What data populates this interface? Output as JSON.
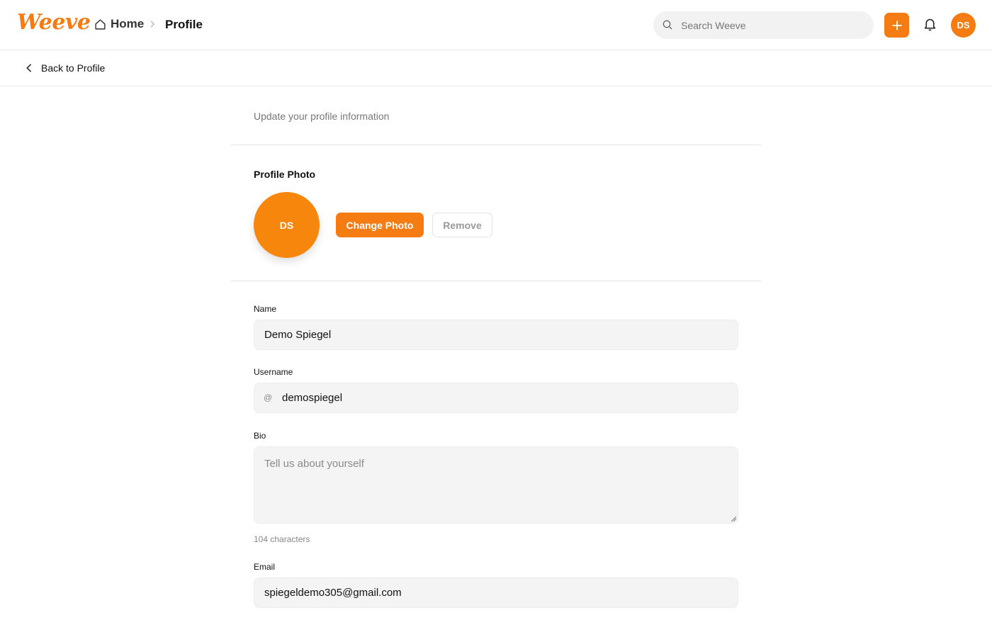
{
  "header": {
    "logo": "Weeve",
    "breadcrumb": {
      "home": "Home",
      "current": "Profile"
    },
    "search": {
      "placeholder": "Search Weeve",
      "value": ""
    },
    "user_initials": "DS",
    "accent": "#f47c12"
  },
  "subheader": {
    "back_label": "Back to Profile"
  },
  "content": {
    "subtitle": "Update your profile information",
    "photo": {
      "section_title": "Profile Photo",
      "initials": "DS",
      "change_label": "Change Photo",
      "remove_label": "Remove"
    },
    "form": {
      "name": {
        "label": "Name",
        "value": "Demo Spiegel"
      },
      "username": {
        "label": "Username",
        "prefix": "@",
        "value": "demospiegel"
      },
      "bio": {
        "label": "Bio",
        "placeholder": "Tell us about yourself",
        "value": "",
        "char_count": "104 characters"
      },
      "email": {
        "label": "Email",
        "value": "spiegeldemo305@gmail.com"
      }
    }
  }
}
